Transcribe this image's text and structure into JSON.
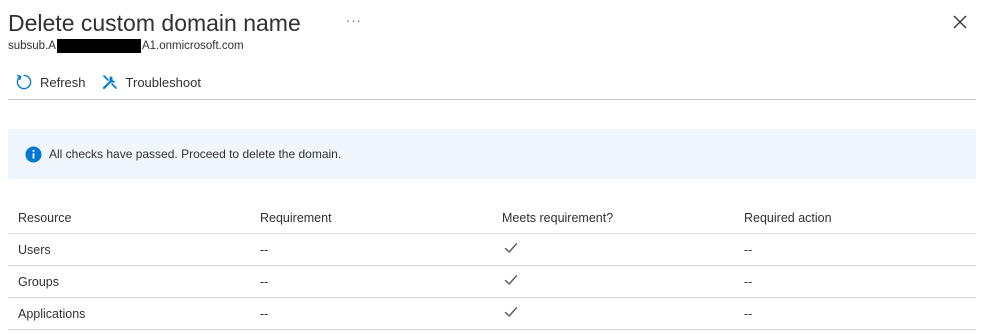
{
  "header": {
    "title": "Delete custom domain name",
    "more_label": "···",
    "subtitle_prefix": "subsub.A",
    "subtitle_suffix": "A1.onmicrosoft.com"
  },
  "toolbar": {
    "refresh_label": "Refresh",
    "troubleshoot_label": "Troubleshoot"
  },
  "info": {
    "message": "All checks have passed. Proceed to delete the domain."
  },
  "table": {
    "columns": [
      "Resource",
      "Requirement",
      "Meets requirement?",
      "Required action"
    ],
    "rows": [
      {
        "resource": "Users",
        "requirement": "--",
        "meets": "check",
        "action": "--"
      },
      {
        "resource": "Groups",
        "requirement": "--",
        "meets": "check",
        "action": "--"
      },
      {
        "resource": "Applications",
        "requirement": "--",
        "meets": "check",
        "action": "--"
      }
    ]
  },
  "icons": {
    "refresh": "refresh-icon",
    "troubleshoot": "wrench-icon",
    "info": "info-icon",
    "close": "close-icon",
    "check": "checkmark-icon"
  },
  "colors": {
    "accent": "#0078d4",
    "info_background": "#eff6fc"
  }
}
